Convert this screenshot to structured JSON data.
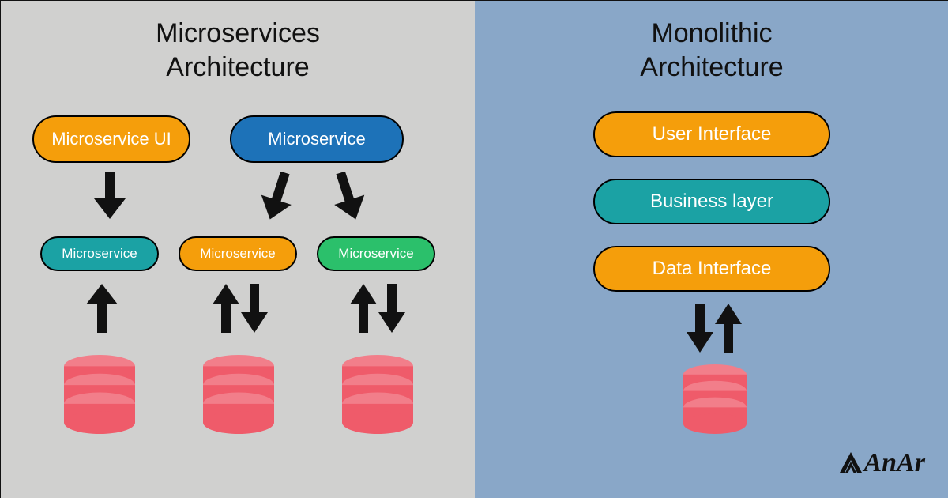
{
  "left": {
    "title": "Microservices\nArchitecture",
    "nodes": {
      "top_ui": {
        "label": "Microservice UI",
        "color": "orange"
      },
      "top_svc": {
        "label": "Microservice",
        "color": "blue"
      },
      "mid_teal": {
        "label": "Microservice",
        "color": "teal"
      },
      "mid_org": {
        "label": "Microservice",
        "color": "orange"
      },
      "mid_grn": {
        "label": "Microservice",
        "color": "green"
      }
    }
  },
  "right": {
    "title": "Monolithic\nArchitecture",
    "layers": {
      "ui": {
        "label": "User Interface",
        "color": "orange"
      },
      "biz": {
        "label": "Business layer",
        "color": "teal"
      },
      "data": {
        "label": "Data Interface",
        "color": "orange"
      }
    }
  },
  "brand": "AnAr",
  "colors": {
    "orange": "#f59e0b",
    "blue": "#1d72b8",
    "teal": "#1ba2a4",
    "green": "#2bc06b",
    "db_red": "#ef5b6a",
    "db_red_top": "#f27e8a"
  }
}
